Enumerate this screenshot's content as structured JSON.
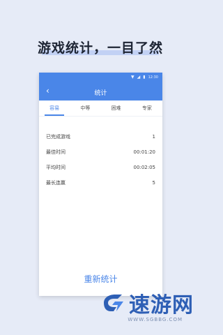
{
  "banner": {
    "headline": "游戏统计，一目了然"
  },
  "phone": {
    "statusbar": {
      "time": "12:30"
    },
    "appbar": {
      "title": "统计"
    },
    "tabs": [
      {
        "label": "容易",
        "active": true
      },
      {
        "label": "中等",
        "active": false
      },
      {
        "label": "困难",
        "active": false
      },
      {
        "label": "专家",
        "active": false
      }
    ],
    "stats": [
      {
        "label": "已完成游戏",
        "value": "1"
      },
      {
        "label": "最佳时间",
        "value": "00:01:20"
      },
      {
        "label": "平均时间",
        "value": "00:02:05"
      },
      {
        "label": "最长连赢",
        "value": "5"
      }
    ],
    "reset_label": "重新统计"
  },
  "watermark": {
    "brand": "速游网",
    "domain": "WWW.SGBBG.COM"
  },
  "colors": {
    "accent": "#4a86e8",
    "background": "#e6ebf7"
  }
}
